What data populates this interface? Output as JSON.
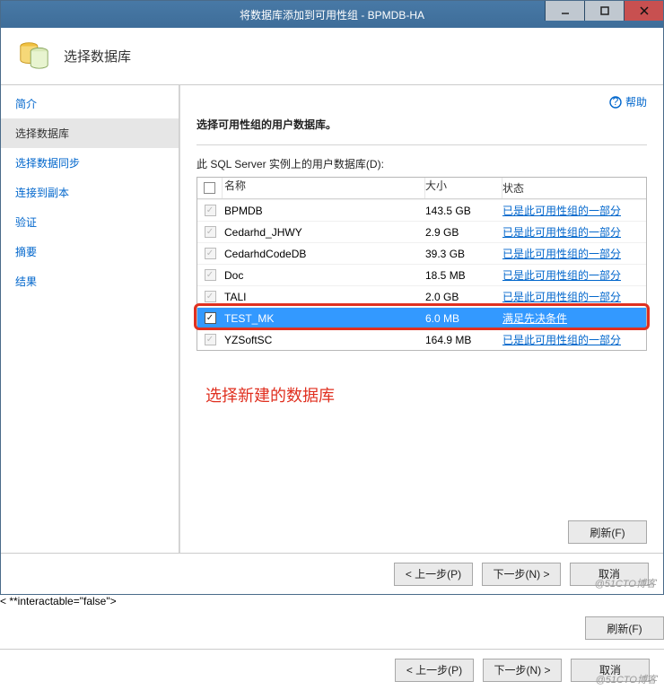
{
  "window": {
    "title": "将数据库添加到可用性组 - BPMDB-HA"
  },
  "header": {
    "title": "选择数据库"
  },
  "help": {
    "label": "帮助"
  },
  "nav": {
    "items": [
      {
        "key": "intro",
        "label": "简介",
        "selected": false
      },
      {
        "key": "select-db",
        "label": "选择数据库",
        "selected": true
      },
      {
        "key": "select-sync",
        "label": "选择数据同步",
        "selected": false
      },
      {
        "key": "connect-replica",
        "label": "连接到副本",
        "selected": false
      },
      {
        "key": "verify",
        "label": "验证",
        "selected": false
      },
      {
        "key": "summary",
        "label": "摘要",
        "selected": false
      },
      {
        "key": "result",
        "label": "结果",
        "selected": false
      }
    ]
  },
  "main": {
    "section_title": "选择可用性组的用户数据库。",
    "list_label": "此 SQL Server 实例上的用户数据库(D):",
    "columns": {
      "name": "名称",
      "size": "大小",
      "status": "状态"
    },
    "rows": [
      {
        "name": "BPMDB",
        "size": "143.5 GB",
        "status": "已是此可用性组的一部分",
        "state": "member"
      },
      {
        "name": "Cedarhd_JHWY",
        "size": "2.9 GB",
        "status": "已是此可用性组的一部分",
        "state": "member"
      },
      {
        "name": "CedarhdCodeDB",
        "size": "39.3 GB",
        "status": "已是此可用性组的一部分",
        "state": "member"
      },
      {
        "name": "Doc",
        "size": "18.5 MB",
        "status": "已是此可用性组的一部分",
        "state": "member"
      },
      {
        "name": "TALI",
        "size": "2.0 GB",
        "status": "已是此可用性组的一部分",
        "state": "member"
      },
      {
        "name": "TEST_MK",
        "size": "6.0 MB",
        "status": "满足先决条件",
        "state": "selected"
      },
      {
        "name": "YZSoftSC",
        "size": "164.9 MB",
        "status": "已是此可用性组的一部分",
        "state": "member"
      }
    ],
    "annotation": "选择新建的数据库",
    "refresh_label": "刷新(F)"
  },
  "footer": {
    "prev": "< 上一步(P)",
    "next": "下一步(N) >",
    "cancel": "取消"
  },
  "watermark": "@51CTO博客"
}
